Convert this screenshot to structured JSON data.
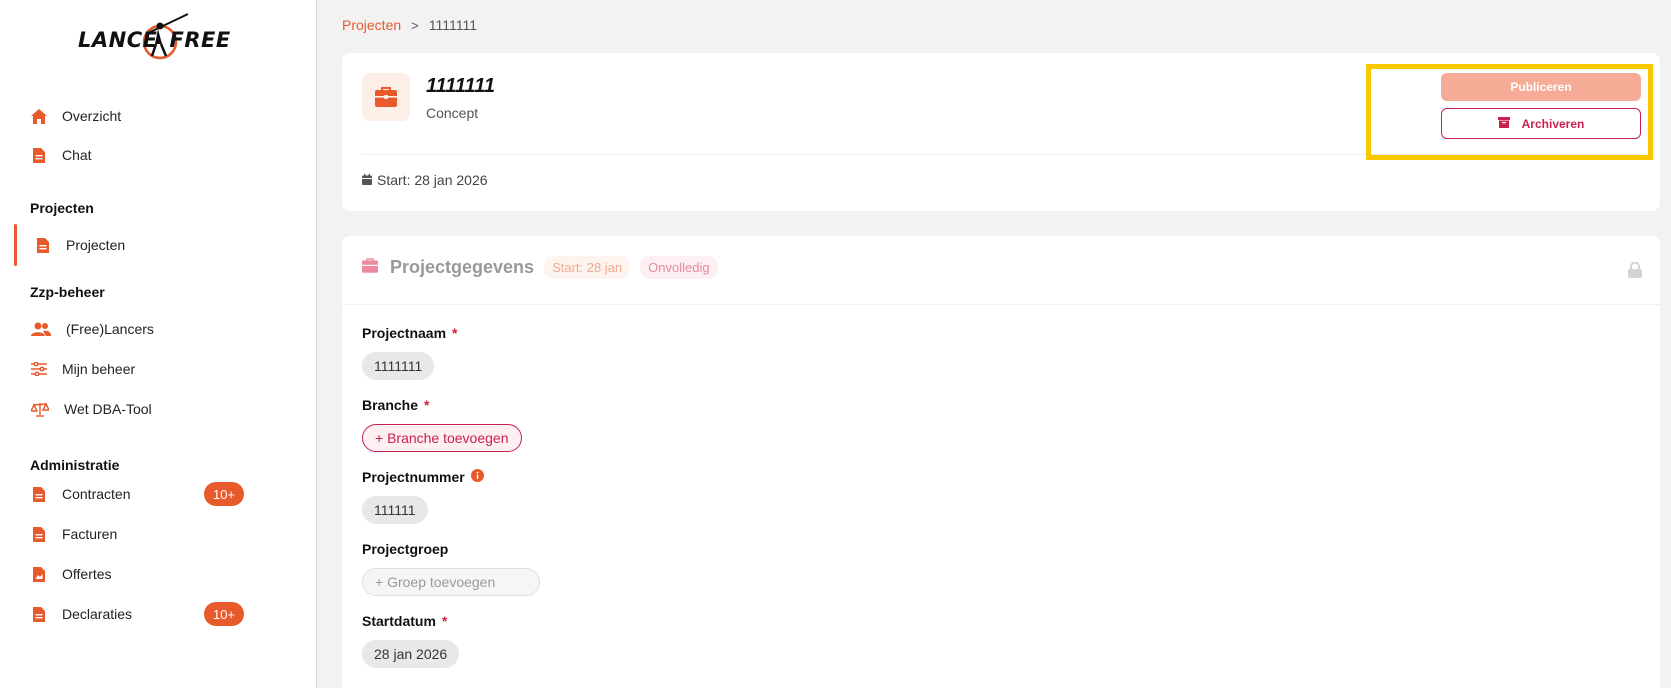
{
  "brand": {
    "logo_left": "LANCE",
    "logo_right": "FREE",
    "accent_color": "#e8592b"
  },
  "sidebar": {
    "items_top": [
      {
        "label": "Overzicht",
        "icon": "home-icon"
      },
      {
        "label": "Chat",
        "icon": "document-icon"
      }
    ],
    "sections": [
      {
        "title": "Projecten",
        "items": [
          {
            "label": "Projecten",
            "icon": "document-icon",
            "active": true
          }
        ]
      },
      {
        "title": "Zzp-beheer",
        "items": [
          {
            "label": "(Free)Lancers",
            "icon": "users-icon"
          },
          {
            "label": "Mijn beheer",
            "icon": "sliders-icon"
          },
          {
            "label": "Wet DBA-Tool",
            "icon": "scale-icon"
          }
        ]
      },
      {
        "title": "Administratie",
        "items": [
          {
            "label": "Contracten",
            "icon": "document-icon",
            "badge": "10+"
          },
          {
            "label": "Facturen",
            "icon": "document-icon"
          },
          {
            "label": "Offertes",
            "icon": "document-icon"
          },
          {
            "label": "Declaraties",
            "icon": "document-icon",
            "badge": "10+"
          }
        ]
      }
    ]
  },
  "breadcrumb": {
    "parent": "Projecten",
    "separator": ">",
    "current": "1111111"
  },
  "project_header": {
    "title": "1111111",
    "status": "Concept",
    "start": "Start: 28 jan 2026",
    "publish_label": "Publiceren",
    "archive_label": "Archiveren"
  },
  "project_details": {
    "title": "Projectgegevens",
    "start_pill": "Start: 28 jan",
    "status_pill": "Onvolledig",
    "fields": {
      "name_label": "Projectnaam",
      "name_value": "1111111",
      "branch_label": "Branche",
      "branch_add": "+ Branche toevoegen",
      "number_label": "Projectnummer",
      "number_value": "111111",
      "group_label": "Projectgroep",
      "group_placeholder": "+ Groep toevoegen",
      "startdate_label": "Startdatum",
      "startdate_value": "28 jan 2026",
      "required_marker": "*"
    }
  }
}
